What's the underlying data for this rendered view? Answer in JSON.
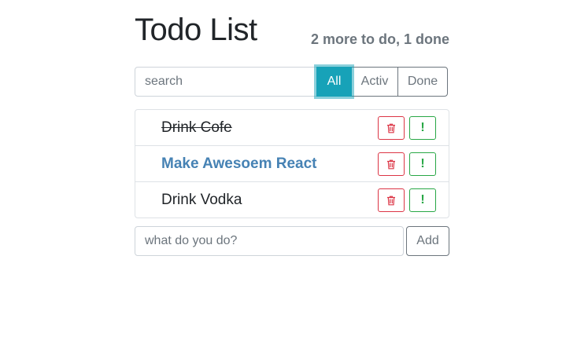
{
  "header": {
    "title": "Todo List",
    "status": "2 more to do, 1 done"
  },
  "search": {
    "placeholder": "search",
    "value": ""
  },
  "filters": [
    {
      "label": "All",
      "active": true
    },
    {
      "label": "Activ",
      "active": false
    },
    {
      "label": "Done",
      "active": false
    }
  ],
  "todos": [
    {
      "label": "Drink Cofe",
      "done": true,
      "important": false
    },
    {
      "label": "Make Awesoem React",
      "done": false,
      "important": true
    },
    {
      "label": "Drink Vodka",
      "done": false,
      "important": false
    }
  ],
  "item_buttons": {
    "delete_icon": "trash-icon",
    "important_label": "!"
  },
  "add_form": {
    "placeholder": "what do you do?",
    "button_label": "Add"
  },
  "colors": {
    "filter_active": "#17a2b8",
    "important_text": "#4682b4",
    "delete": "#dc3545",
    "important_button": "#28a745"
  }
}
